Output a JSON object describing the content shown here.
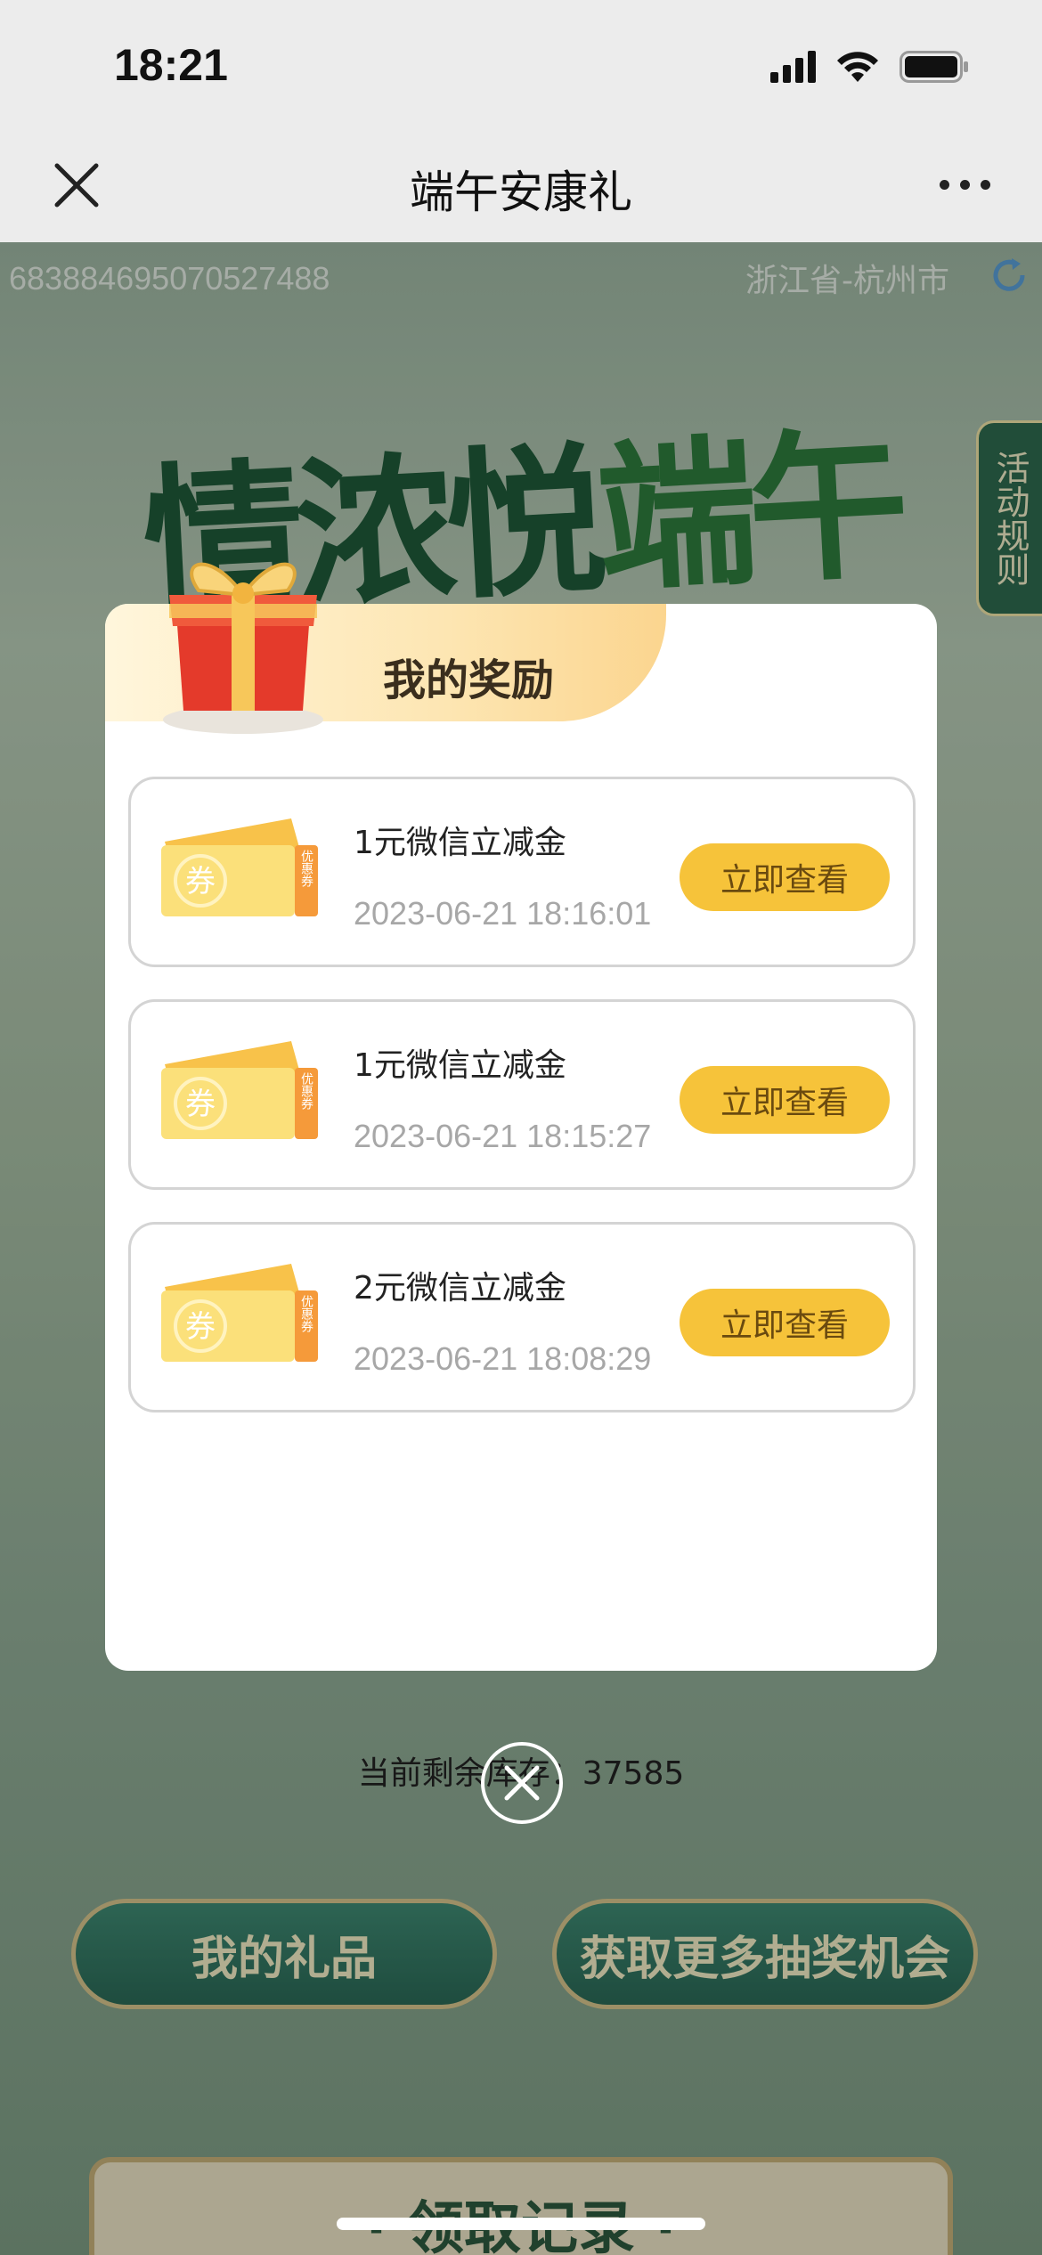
{
  "status_bar": {
    "time": "18:21"
  },
  "nav": {
    "title": "端午安康礼"
  },
  "page": {
    "user_id": "683884695070527488",
    "location": "浙江省-杭州市",
    "hero_title_part1": "情浓悦",
    "hero_title_part2": "端午",
    "rules_label": "活动规则",
    "stock_text": "当前剩余库存：37585",
    "my_gifts_label": "我的礼品",
    "more_chances_label": "获取更多抽奖机会",
    "records_label": "· 领取记录 ·"
  },
  "modal": {
    "title": "我的奖励",
    "rewards": [
      {
        "name": "1元微信立减金",
        "time": "2023-06-21 18:16:01",
        "button": "立即查看"
      },
      {
        "name": "1元微信立减金",
        "time": "2023-06-21 18:15:27",
        "button": "立即查看"
      },
      {
        "name": "2元微信立减金",
        "time": "2023-06-21 18:08:29",
        "button": "立即查看"
      }
    ],
    "coupon_text": "券",
    "coupon_side_text": "优惠券"
  },
  "colors": {
    "accent_yellow": "#f6c33a",
    "card_border": "#d4d4d4",
    "header_gradient_end": "#fbd58f"
  }
}
